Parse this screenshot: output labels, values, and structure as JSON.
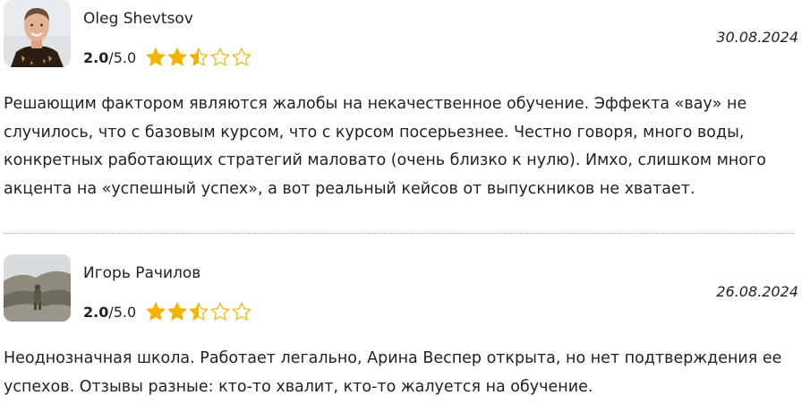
{
  "reviews": [
    {
      "author": "Oleg Shevtsov",
      "rating": "2.0",
      "rating_separator": "/",
      "rating_max": "5.0",
      "stars_filled": 2.5,
      "stars_total": 5,
      "date": "30.08.2024",
      "text": "Решающим фактором являются жалобы на некачественное обучение. Эффекта «вау» не случилось, что с базовым курсом, что с курсом посерьезнее. Честно говоря, много воды, конкретных работающих стратегий маловато (очень близко к нулю). Имхо, слишком много акцента на «успешный успех», а вот реальный кейсов от выпускников не хватает.",
      "avatar": "person-portrait"
    },
    {
      "author": "Игорь Рачилов",
      "rating": "2.0",
      "rating_separator": "/",
      "rating_max": "5.0",
      "stars_filled": 2.5,
      "stars_total": 5,
      "date": "26.08.2024",
      "text": "Неоднозначная школа. Работает легально, Арина Веспер открыта, но нет подтверждения ее успехов. Отзывы разные: кто-то хвалит, кто-то жалуется на обучение.",
      "avatar": "landscape-photo"
    }
  ],
  "colors": {
    "star": "#f5b301",
    "text": "#222222",
    "divider": "#aaaaaa"
  }
}
